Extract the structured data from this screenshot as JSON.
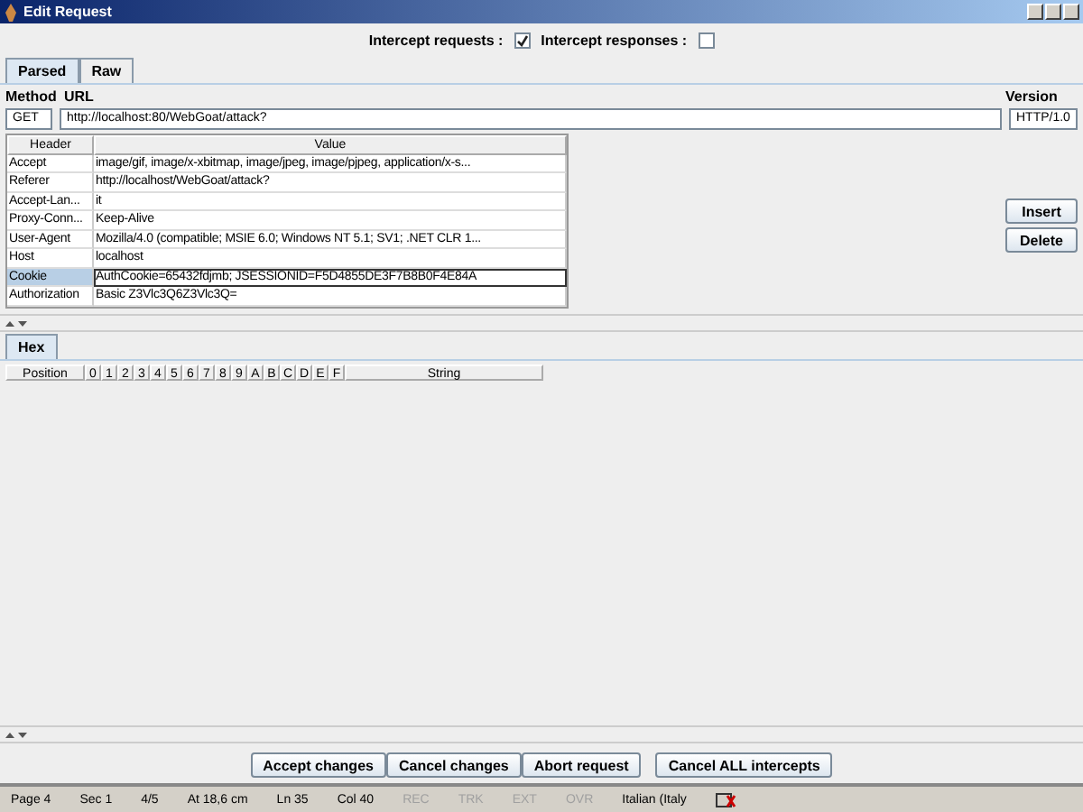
{
  "window": {
    "title": "Edit Request"
  },
  "intercept": [
    {
      "label": "Intercept requests :",
      "checked": true
    },
    {
      "label": "Intercept responses :",
      "checked": false
    }
  ],
  "tabs": [
    {
      "label": "Parsed",
      "selected": true
    },
    {
      "label": "Raw",
      "selected": false
    }
  ],
  "request": {
    "method_label": "Method",
    "url_label": "URL",
    "version_label": "Version",
    "method": "GET",
    "url": "http://localhost:80/WebGoat/attack?",
    "version": "HTTP/1.0"
  },
  "headers_table": {
    "columns": [
      "Header",
      "Value"
    ],
    "rows": [
      {
        "name": "Accept",
        "value": "image/gif, image/x-xbitmap, image/jpeg, image/pjpeg, application/x-s...",
        "selected": false
      },
      {
        "name": "Referer",
        "value": "http://localhost/WebGoat/attack?",
        "selected": false
      },
      {
        "name": "Accept-Lan...",
        "value": "it",
        "selected": false
      },
      {
        "name": "Proxy-Conn...",
        "value": "Keep-Alive",
        "selected": false
      },
      {
        "name": "User-Agent",
        "value": "Mozilla/4.0 (compatible; MSIE 6.0; Windows NT 5.1; SV1; .NET CLR 1...",
        "selected": false
      },
      {
        "name": "Host",
        "value": "localhost",
        "selected": false
      },
      {
        "name": "Cookie",
        "value": "AuthCookie=65432fdjmb; JSESSIONID=F5D4855DE3F7B8B0F4E84A",
        "selected": true
      },
      {
        "name": "Authorization",
        "value": "Basic Z3Vlc3Q6Z3Vlc3Q=",
        "selected": false
      }
    ]
  },
  "side_buttons": [
    "Insert",
    "Delete"
  ],
  "hex_tab": {
    "label": "Hex",
    "selected": true
  },
  "hex_columns": [
    "Position",
    "0",
    "1",
    "2",
    "3",
    "4",
    "5",
    "6",
    "7",
    "8",
    "9",
    "A",
    "B",
    "C",
    "D",
    "E",
    "F",
    "String"
  ],
  "buttons": [
    "Accept changes",
    "Cancel changes",
    "Abort request",
    "Cancel ALL intercepts"
  ],
  "status_bar": [
    {
      "text": "Page 4",
      "disabled": false
    },
    {
      "text": "Sec 1",
      "disabled": false
    },
    {
      "text": "4/5",
      "disabled": false
    },
    {
      "text": "At 18,6 cm",
      "disabled": false
    },
    {
      "text": "Ln 35",
      "disabled": false
    },
    {
      "text": "Col 40",
      "disabled": false
    },
    {
      "text": "REC",
      "disabled": true
    },
    {
      "text": "TRK",
      "disabled": true
    },
    {
      "text": "EXT",
      "disabled": true
    },
    {
      "text": "OVR",
      "disabled": true
    },
    {
      "text": "Italian (Italy",
      "disabled": false
    }
  ]
}
